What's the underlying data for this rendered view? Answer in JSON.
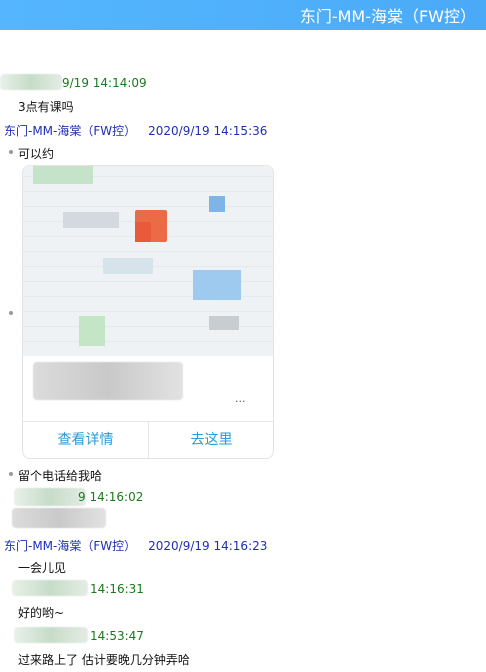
{
  "window": {
    "title": "东门-MM-海棠（FW控）"
  },
  "messages": [
    {
      "sender": "",
      "time": "9/19 14:14:09",
      "text": "3点有课吗"
    },
    {
      "sender": "东门-MM-海棠（FW控）",
      "time": "2020/9/19 14:15:36",
      "text": "可以约"
    },
    {
      "sender": "",
      "time": "",
      "text": ""
    },
    {
      "sender": "",
      "time": "",
      "text": "留个电话给我哈"
    },
    {
      "sender": "",
      "time": "9 14:16:02",
      "text": ""
    },
    {
      "sender": "东门-MM-海棠（FW控）",
      "time": "2020/9/19 14:16:23",
      "text": "一会儿见"
    },
    {
      "sender": "",
      "time": "14:16:31",
      "text": "好的哟~"
    },
    {
      "sender": "",
      "time": "14:53:47",
      "text": "过来路上了 估计要晚几分钟弄哈"
    }
  ],
  "location_card": {
    "address_partial": "...",
    "view_details_label": "查看详情",
    "go_here_label": "去这里"
  }
}
